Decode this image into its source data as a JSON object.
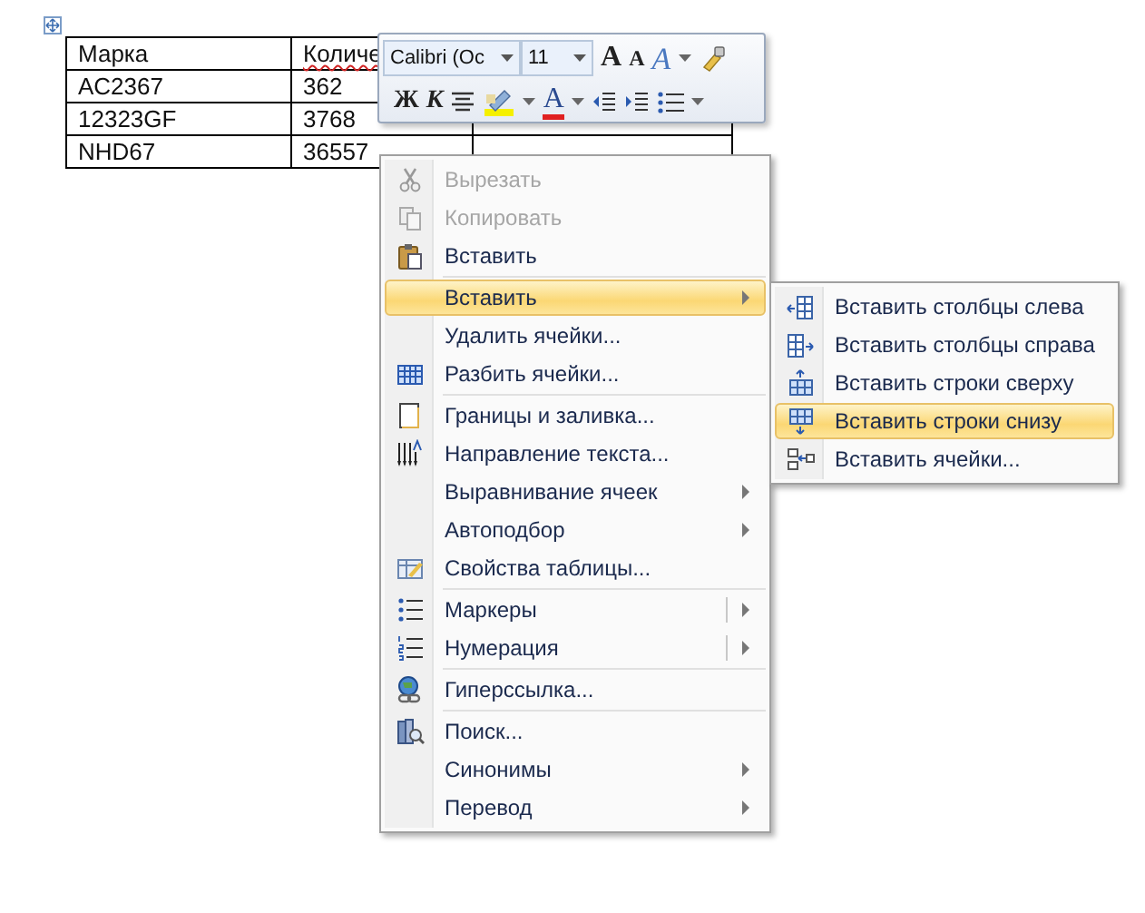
{
  "table": {
    "header": [
      "Марка",
      "Количе"
    ],
    "rows": [
      [
        "AC2367",
        "362"
      ],
      [
        "12323GF",
        "3768"
      ],
      [
        "NHD67",
        "36557"
      ]
    ]
  },
  "toolbar": {
    "font_field": {
      "value": "Calibri (Oc"
    },
    "size_field": {
      "value": "11"
    },
    "grow_label": "A",
    "shrink_label": "A",
    "styles_label": "A",
    "bold_label": "Ж",
    "italic_label": "К",
    "font_color_label": "A"
  },
  "menu": [
    {
      "kind": "item",
      "label": "Вырезать",
      "disabled": true,
      "selected": false,
      "has_submenu": false,
      "split": false
    },
    {
      "kind": "item",
      "label": "Копировать",
      "disabled": true,
      "selected": false,
      "has_submenu": false,
      "split": false
    },
    {
      "kind": "item",
      "label": "Вставить",
      "disabled": false,
      "selected": false,
      "has_submenu": false,
      "split": false
    },
    {
      "kind": "separator"
    },
    {
      "kind": "item",
      "label": "Вставить",
      "disabled": false,
      "selected": true,
      "has_submenu": true,
      "split": false
    },
    {
      "kind": "item",
      "label": "Удалить ячейки...",
      "disabled": false,
      "selected": false,
      "has_submenu": false,
      "split": false
    },
    {
      "kind": "item",
      "label": "Разбить ячейки...",
      "disabled": false,
      "selected": false,
      "has_submenu": false,
      "split": false
    },
    {
      "kind": "separator"
    },
    {
      "kind": "item",
      "label": "Границы и заливка...",
      "disabled": false,
      "selected": false,
      "has_submenu": false,
      "split": false
    },
    {
      "kind": "item",
      "label": "Направление текста...",
      "disabled": false,
      "selected": false,
      "has_submenu": false,
      "split": false
    },
    {
      "kind": "item",
      "label": "Выравнивание ячеек",
      "disabled": false,
      "selected": false,
      "has_submenu": true,
      "split": false
    },
    {
      "kind": "item",
      "label": "Автоподбор",
      "disabled": false,
      "selected": false,
      "has_submenu": true,
      "split": false
    },
    {
      "kind": "item",
      "label": "Свойства таблицы...",
      "disabled": false,
      "selected": false,
      "has_submenu": false,
      "split": false
    },
    {
      "kind": "separator"
    },
    {
      "kind": "item",
      "label": "Маркеры",
      "disabled": false,
      "selected": false,
      "has_submenu": true,
      "split": true
    },
    {
      "kind": "item",
      "label": "Нумерация",
      "disabled": false,
      "selected": false,
      "has_submenu": true,
      "split": true
    },
    {
      "kind": "separator"
    },
    {
      "kind": "item",
      "label": "Гиперссылка...",
      "disabled": false,
      "selected": false,
      "has_submenu": false,
      "split": false
    },
    {
      "kind": "separator"
    },
    {
      "kind": "item",
      "label": "Поиск...",
      "disabled": false,
      "selected": false,
      "has_submenu": false,
      "split": false
    },
    {
      "kind": "item",
      "label": "Синонимы",
      "disabled": false,
      "selected": false,
      "has_submenu": true,
      "split": false
    },
    {
      "kind": "item",
      "label": "Перевод",
      "disabled": false,
      "selected": false,
      "has_submenu": true,
      "split": false
    }
  ],
  "submenu": [
    {
      "label": "Вставить столбцы слева",
      "selected": false
    },
    {
      "label": "Вставить столбцы справа",
      "selected": false
    },
    {
      "label": "Вставить строки сверху",
      "selected": false
    },
    {
      "label": "Вставить строки снизу",
      "selected": true
    },
    {
      "label": "Вставить ячейки...",
      "selected": false
    }
  ]
}
